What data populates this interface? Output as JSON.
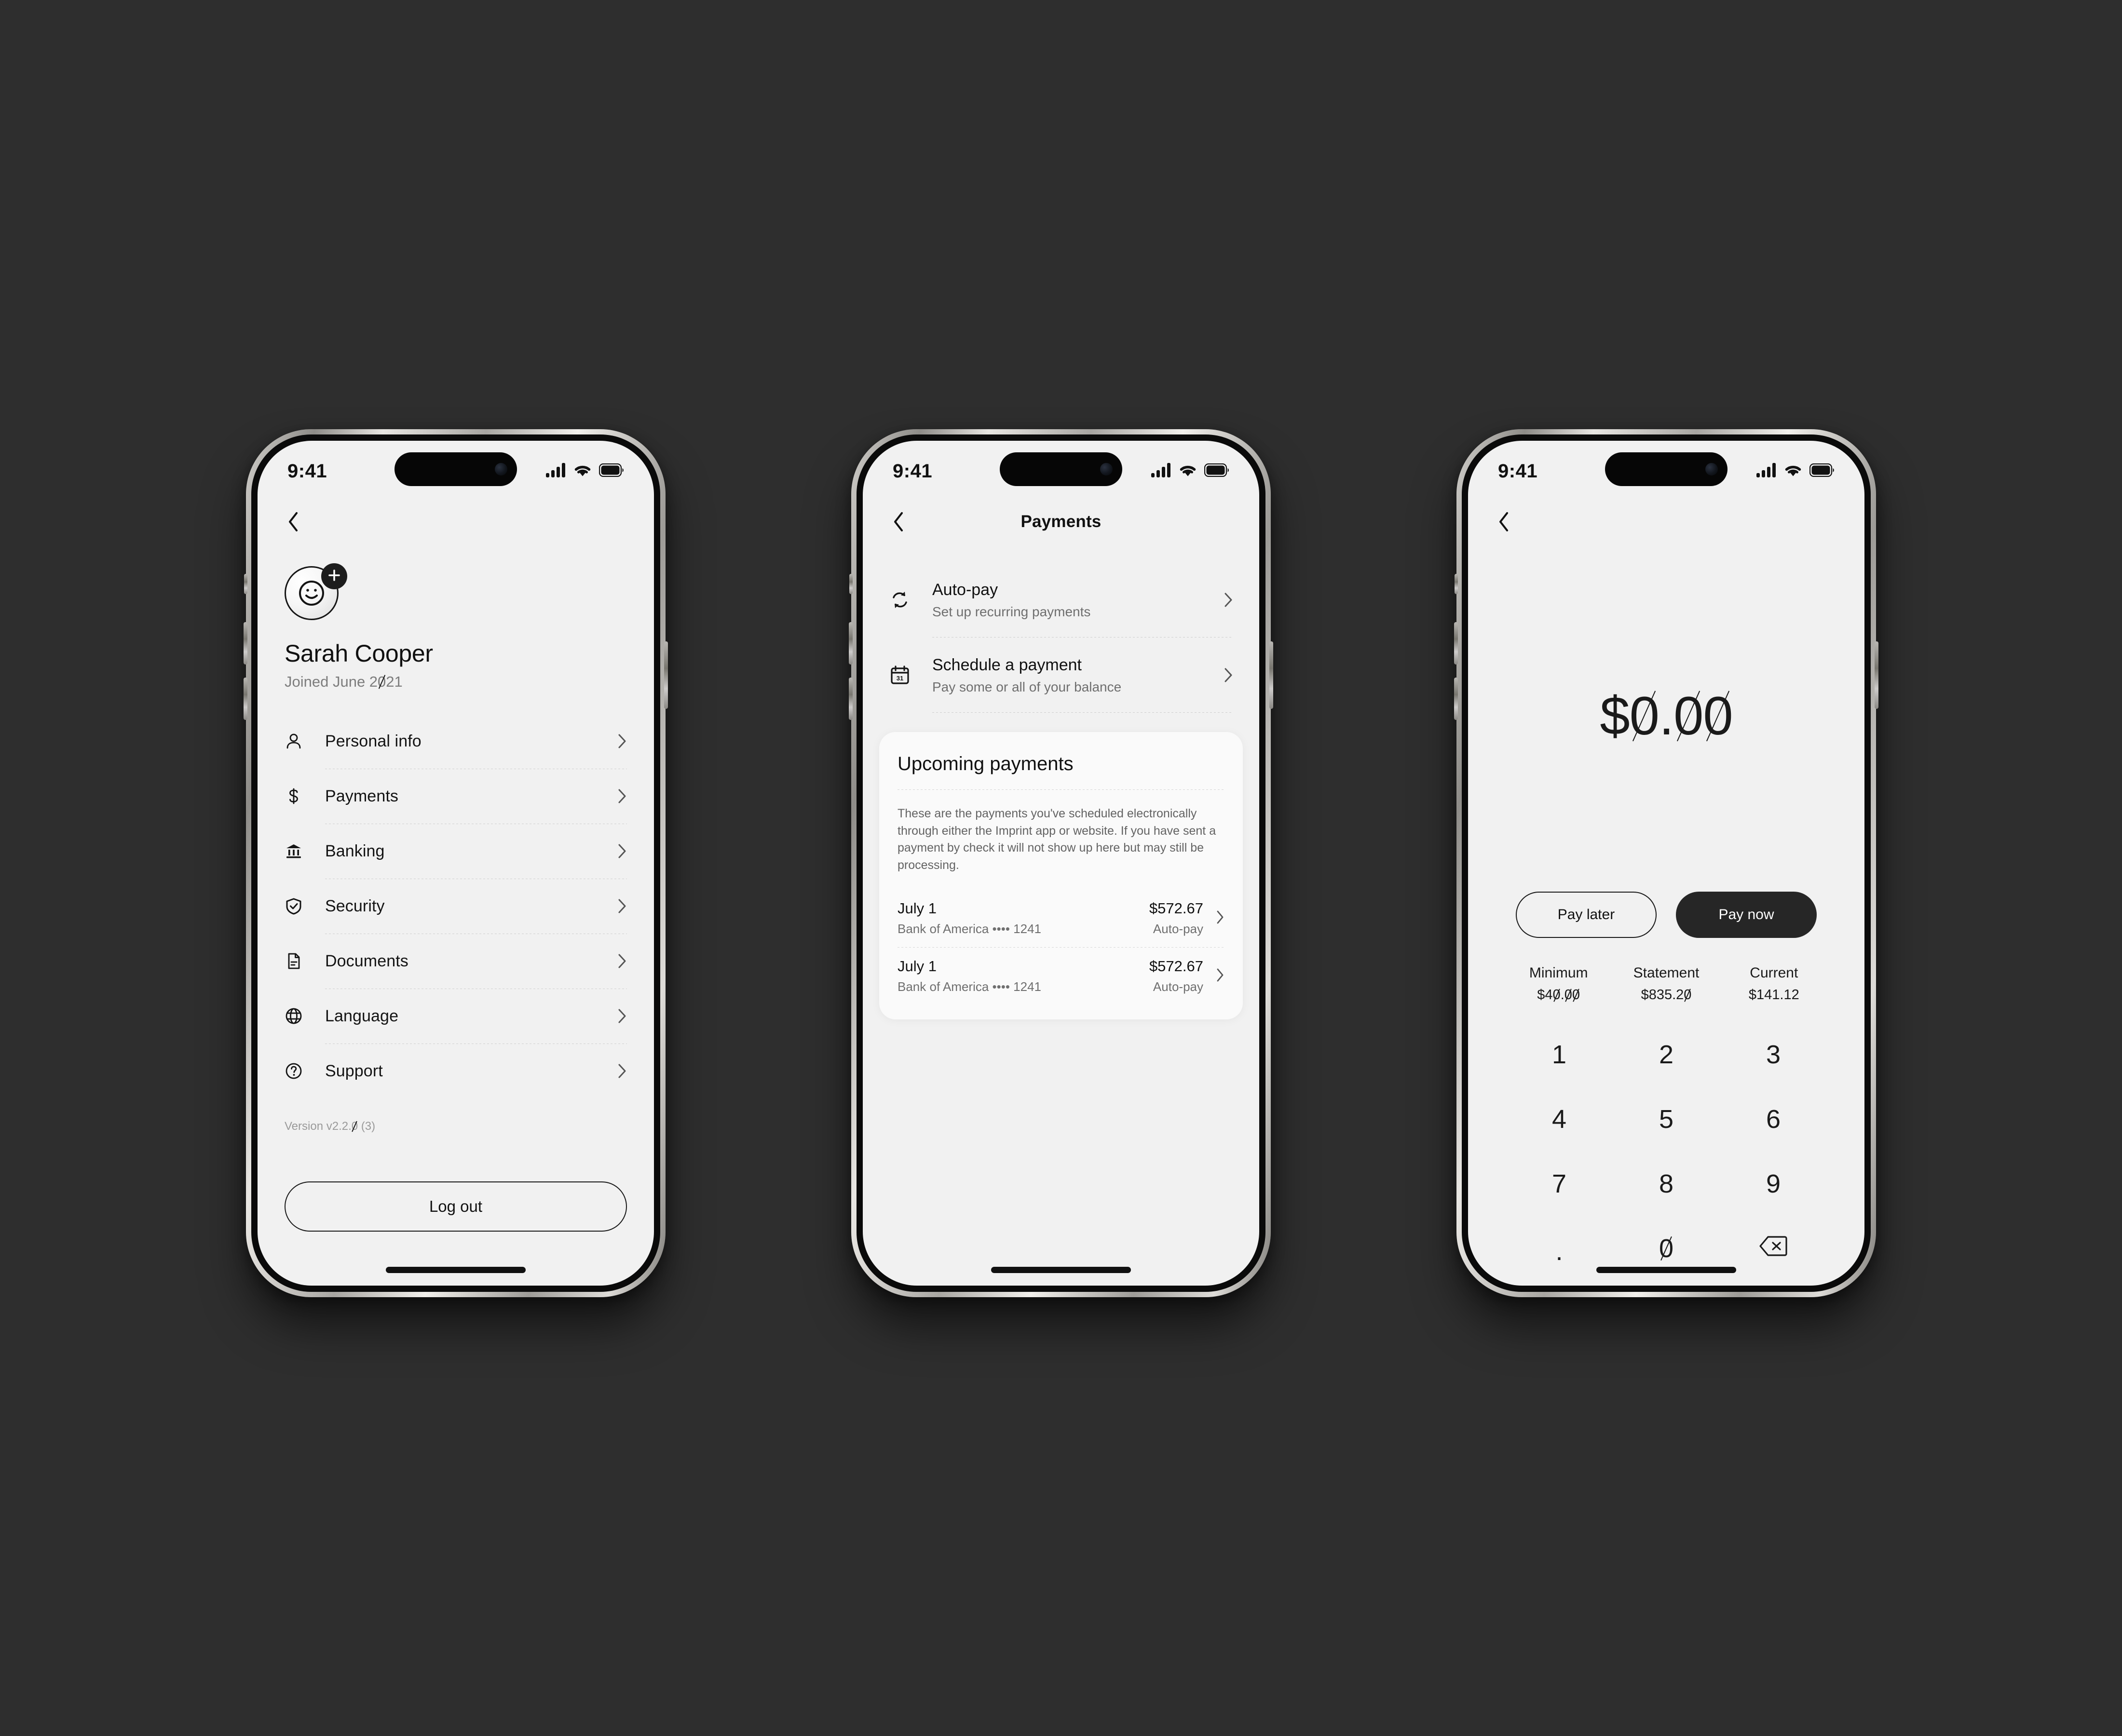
{
  "background_color": "#2e2e2e",
  "screens": [
    {
      "id": "profile",
      "status_bar": {
        "time": "9:41",
        "cellular_icon": "cellular-bars-icon",
        "wifi_icon": "wifi-icon",
        "battery_icon": "battery-icon"
      },
      "nav": {
        "back_icon": "chevron-left-icon",
        "title": ""
      },
      "profile": {
        "avatar_icon": "smiley-avatar-icon",
        "add_photo_icon": "plus-icon",
        "name": "Sarah Cooper",
        "joined": "Joined June 2021"
      },
      "menu": [
        {
          "label": "Personal info",
          "icon": "person-icon",
          "chevron": "chevron-right-icon"
        },
        {
          "label": "Payments",
          "icon": "dollar-icon",
          "chevron": "chevron-right-icon"
        },
        {
          "label": "Banking",
          "icon": "bank-icon",
          "chevron": "chevron-right-icon"
        },
        {
          "label": "Security",
          "icon": "shield-check-icon",
          "chevron": "chevron-right-icon"
        },
        {
          "label": "Documents",
          "icon": "document-icon",
          "chevron": "chevron-right-icon"
        },
        {
          "label": "Language",
          "icon": "globe-icon",
          "chevron": "chevron-right-icon"
        },
        {
          "label": "Support",
          "icon": "question-circle-icon",
          "chevron": "chevron-right-icon"
        }
      ],
      "version": "Version v2.2.0 (3)",
      "logout_label": "Log out"
    },
    {
      "id": "payments",
      "status_bar": {
        "time": "9:41",
        "cellular_icon": "cellular-bars-icon",
        "wifi_icon": "wifi-icon",
        "battery_icon": "battery-icon"
      },
      "nav": {
        "back_icon": "chevron-left-icon",
        "title": "Payments"
      },
      "options": [
        {
          "title": "Auto-pay",
          "subtitle": "Set up recurring payments",
          "icon": "recurring-arrows-icon",
          "chevron": "chevron-right-icon"
        },
        {
          "title": "Schedule a payment",
          "subtitle": "Pay some or all of your balance",
          "icon": "calendar-31-icon",
          "chevron": "chevron-right-icon"
        }
      ],
      "upcoming": {
        "title": "Upcoming payments",
        "note": "These are the payments you've scheduled electronically through either the Imprint app or website. If you have sent a payment by check it will not show up here but may still be processing.",
        "rows": [
          {
            "date": "July 1",
            "source": "Bank of America •••• 1241",
            "amount": "$572.67",
            "type": "Auto-pay",
            "chevron": "chevron-right-icon"
          },
          {
            "date": "July 1",
            "source": "Bank of America •••• 1241",
            "amount": "$572.67",
            "type": "Auto-pay",
            "chevron": "chevron-right-icon"
          }
        ]
      }
    },
    {
      "id": "amount-entry",
      "status_bar": {
        "time": "9:41",
        "cellular_icon": "cellular-bars-icon",
        "wifi_icon": "wifi-icon",
        "battery_icon": "battery-icon"
      },
      "nav": {
        "back_icon": "chevron-left-icon",
        "title": ""
      },
      "amount": "$0.00",
      "buttons": {
        "secondary": "Pay later",
        "primary": "Pay now"
      },
      "balances": [
        {
          "label": "Minimum",
          "value": "$40.00"
        },
        {
          "label": "Statement",
          "value": "$835.20"
        },
        {
          "label": "Current",
          "value": "$141.12"
        }
      ],
      "keypad": [
        {
          "key": "1"
        },
        {
          "key": "2"
        },
        {
          "key": "3"
        },
        {
          "key": "4"
        },
        {
          "key": "5"
        },
        {
          "key": "6"
        },
        {
          "key": "7"
        },
        {
          "key": "8"
        },
        {
          "key": "9"
        },
        {
          "key": "."
        },
        {
          "key": "0"
        },
        {
          "key": "",
          "icon": "backspace-icon"
        }
      ]
    }
  ]
}
